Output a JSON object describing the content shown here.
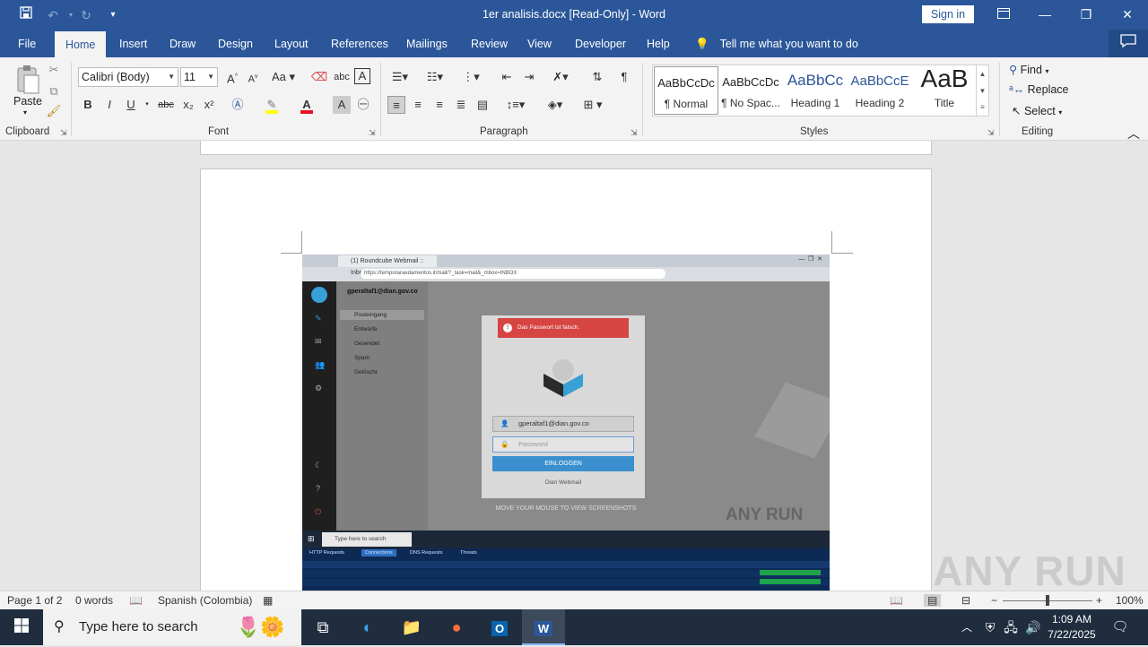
{
  "titlebar": {
    "title": "1er analisis.docx [Read-Only]  -  Word",
    "sign_in": "Sign in"
  },
  "tabs": [
    "File",
    "Home",
    "Insert",
    "Draw",
    "Design",
    "Layout",
    "References",
    "Mailings",
    "Review",
    "View",
    "Developer",
    "Help"
  ],
  "tell_me": "Tell me what you want to do",
  "ribbon": {
    "clipboard": {
      "paste": "Paste",
      "label": "Clipboard"
    },
    "font": {
      "name": "Calibri (Body)",
      "size": "11",
      "label": "Font",
      "buttons": [
        "B",
        "I",
        "U",
        "abc",
        "x₂",
        "x²"
      ]
    },
    "paragraph": {
      "label": "Paragraph"
    },
    "styles": {
      "label": "Styles",
      "items": [
        {
          "preview": "AaBbCcDc",
          "name": "¶ Normal"
        },
        {
          "preview": "AaBbCcDc",
          "name": "¶ No Spac..."
        },
        {
          "preview": "AaBbCc",
          "name": "Heading 1"
        },
        {
          "preview": "AaBbCcE",
          "name": "Heading 2"
        },
        {
          "preview": "AaB",
          "name": "Title"
        }
      ]
    },
    "editing": {
      "find": "Find",
      "replace": "Replace",
      "select": "Select",
      "label": "Editing"
    }
  },
  "screenshot": {
    "tab_title": "(1) Roundcube Webmail :: Inbox",
    "url": "https://temporaraedamentos.it/mail/?_task=mail&_mbox=INBOX",
    "account": "gperaltaf1@dian.gov.co",
    "folders": [
      "Posteingang",
      "Entwürfe",
      "Gesendet",
      "Spam",
      "Gelöscht"
    ],
    "error": "Das Passwort ist falsch.",
    "username": "gperaltaf1@dian.gov.co",
    "password_placeholder": "Password",
    "login_button": "EINLOGGEN",
    "webmail_label": "Dian Webmail",
    "hint": "MOVE YOUR MOUSE TO VIEW SCREENSHOTS",
    "watermark": "ANY RUN",
    "taskbar_search": "Type here to search",
    "net_tabs": [
      "HTTP Requests",
      "Connections",
      "DNS Requests",
      "Threats"
    ]
  },
  "watermark": "ANY RUN",
  "status": {
    "page": "Page 1 of 2",
    "words": "0 words",
    "language": "Spanish (Colombia)",
    "zoom": "100%"
  },
  "taskbar": {
    "search_placeholder": "Type here to search",
    "time": "1:09 AM",
    "date": "7/22/2025"
  },
  "colors": {
    "word_blue": "#2b579a",
    "ribbon_bg": "#f3f3f3",
    "error_red": "#d64541",
    "login_blue": "#3b8fcf"
  }
}
